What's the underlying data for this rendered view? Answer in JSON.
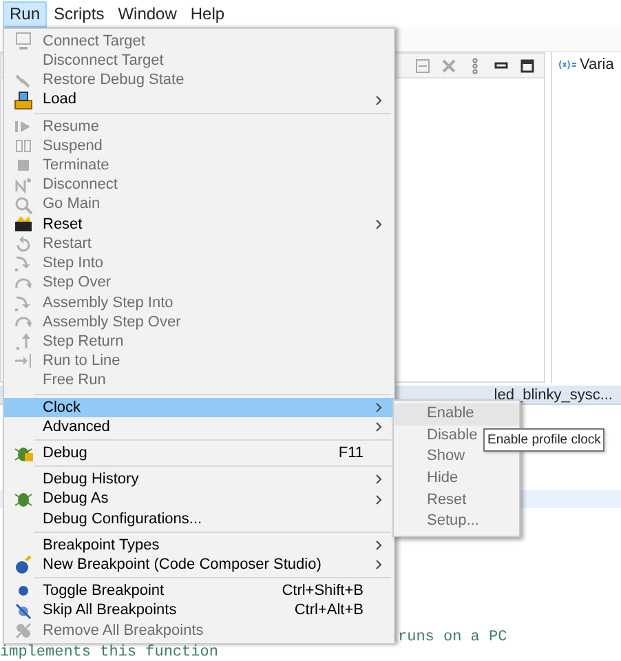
{
  "menubar": [
    {
      "label": "Run",
      "selected": true
    },
    {
      "label": "Scripts",
      "selected": false
    },
    {
      "label": "Window",
      "selected": false
    },
    {
      "label": "Help",
      "selected": false
    }
  ],
  "views": {
    "variables_tab": "Varia",
    "editor_tab": "led_blinky_sysc...",
    "code_lines": [
      "runs on a PC",
      "implements this function"
    ]
  },
  "run_menu": {
    "items": [
      {
        "kind": "connect",
        "label": "Connect Target",
        "disabled": true,
        "selected": false,
        "submenu": false
      },
      {
        "kind": "plain",
        "label": "Disconnect Target",
        "disabled": true,
        "selected": false,
        "submenu": false
      },
      {
        "kind": "restore",
        "label": "Restore Debug State",
        "disabled": true,
        "selected": false,
        "submenu": false
      },
      {
        "kind": "load",
        "label": "Load",
        "disabled": false,
        "selected": false,
        "submenu": true
      },
      {
        "kind": "separator"
      },
      {
        "kind": "resume",
        "label": "Resume",
        "disabled": true,
        "selected": false,
        "submenu": false
      },
      {
        "kind": "suspend",
        "label": "Suspend",
        "disabled": true,
        "selected": false,
        "submenu": false
      },
      {
        "kind": "terminate",
        "label": "Terminate",
        "disabled": true,
        "selected": false,
        "submenu": false
      },
      {
        "kind": "disconnect",
        "label": "Disconnect",
        "disabled": true,
        "selected": false,
        "submenu": false
      },
      {
        "kind": "goto",
        "label": "Go Main",
        "disabled": true,
        "selected": false,
        "submenu": false
      },
      {
        "kind": "reset",
        "label": "Reset",
        "disabled": false,
        "selected": false,
        "submenu": true
      },
      {
        "kind": "restart",
        "label": "Restart",
        "disabled": true,
        "selected": false,
        "submenu": false
      },
      {
        "kind": "stepinto",
        "label": "Step Into",
        "disabled": true,
        "selected": false,
        "submenu": false
      },
      {
        "kind": "stepover",
        "label": "Step Over",
        "disabled": true,
        "selected": false,
        "submenu": false
      },
      {
        "kind": "stepinto",
        "label": "Assembly Step Into",
        "disabled": true,
        "selected": false,
        "submenu": false
      },
      {
        "kind": "stepover",
        "label": "Assembly Step Over",
        "disabled": true,
        "selected": false,
        "submenu": false
      },
      {
        "kind": "stepreturn",
        "label": "Step Return",
        "disabled": true,
        "selected": false,
        "submenu": false
      },
      {
        "kind": "runtoline",
        "label": "Run to Line",
        "disabled": true,
        "selected": false,
        "submenu": false
      },
      {
        "kind": "plain",
        "label": "Free Run",
        "disabled": true,
        "selected": false,
        "submenu": false
      },
      {
        "kind": "separator"
      },
      {
        "kind": "plain",
        "label": "Clock",
        "disabled": false,
        "selected": true,
        "submenu": true
      },
      {
        "kind": "plain",
        "label": "Advanced",
        "disabled": false,
        "selected": false,
        "submenu": true
      },
      {
        "kind": "separator"
      },
      {
        "kind": "debug",
        "label": "Debug",
        "shortcut": "F11",
        "disabled": false,
        "selected": false,
        "submenu": false
      },
      {
        "kind": "separator"
      },
      {
        "kind": "plain",
        "label": "Debug History",
        "disabled": false,
        "selected": false,
        "submenu": true
      },
      {
        "kind": "debugas",
        "label": "Debug As",
        "disabled": false,
        "selected": false,
        "submenu": true
      },
      {
        "kind": "plain",
        "label": "Debug Configurations...",
        "disabled": false,
        "selected": false,
        "submenu": false
      },
      {
        "kind": "separator"
      },
      {
        "kind": "plain",
        "label": "Breakpoint Types",
        "disabled": false,
        "selected": false,
        "submenu": true
      },
      {
        "kind": "newbreakpoint",
        "label": "New Breakpoint (Code Composer Studio)",
        "disabled": false,
        "selected": false,
        "submenu": true
      },
      {
        "kind": "separator"
      },
      {
        "kind": "togglebreakpoint",
        "label": "Toggle Breakpoint",
        "shortcut": "Ctrl+Shift+B",
        "disabled": false,
        "selected": false,
        "submenu": false
      },
      {
        "kind": "skipbreakpoints",
        "label": "Skip All Breakpoints",
        "shortcut": "Ctrl+Alt+B",
        "disabled": false,
        "selected": false,
        "submenu": false
      },
      {
        "kind": "removebreakpoints",
        "label": "Remove All Breakpoints",
        "disabled": true,
        "selected": false,
        "submenu": false
      }
    ]
  },
  "clock_submenu": {
    "items": [
      {
        "label": "Enable",
        "disabled": true,
        "selected": true
      },
      {
        "label": "Disable",
        "disabled": true,
        "selected": false
      },
      {
        "label": "Show",
        "disabled": true,
        "selected": false
      },
      {
        "label": "Hide",
        "disabled": true,
        "selected": false
      },
      {
        "label": "Reset",
        "disabled": true,
        "selected": false
      },
      {
        "label": "Setup...",
        "disabled": true,
        "selected": false
      }
    ]
  },
  "tooltip": "Enable profile clock"
}
